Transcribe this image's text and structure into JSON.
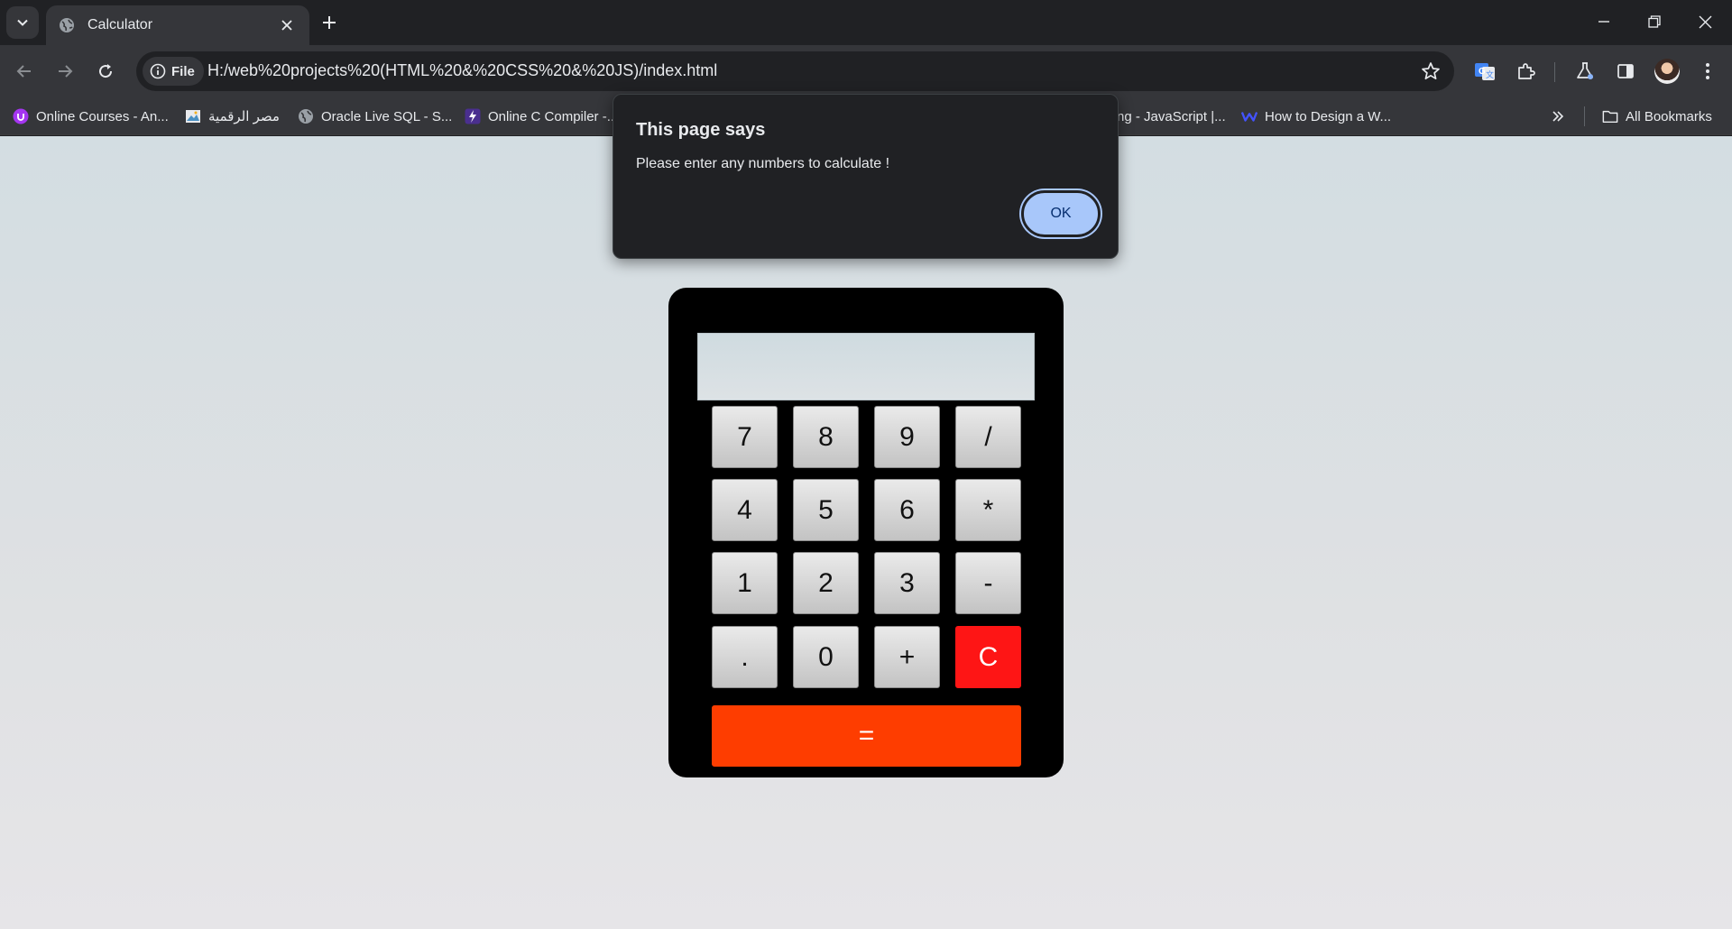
{
  "browser": {
    "tab": {
      "title": "Calculator",
      "favicon": "globe-icon"
    },
    "address": {
      "scheme_chip": "File",
      "url": "H:/web%20projects%20(HTML%20&%20CSS%20&%20JS)/index.html"
    },
    "bookmarks": [
      {
        "label": "Online Courses - An...",
        "icon": "udemy-icon"
      },
      {
        "label": "مصر الرقمية",
        "icon": "image-icon"
      },
      {
        "label": "Oracle Live SQL - S...",
        "icon": "globe-icon"
      },
      {
        "label": "Online C Compiler -...",
        "icon": "lightning-icon"
      },
      {
        "label": "ng - JavaScript |...",
        "icon": "none"
      },
      {
        "label": "How to Design a W...",
        "icon": "w-logo-icon"
      }
    ],
    "all_bookmarks": "All Bookmarks"
  },
  "dialog": {
    "title": "This page says",
    "message": "Please enter any numbers to calculate !",
    "ok_label": "OK"
  },
  "calculator": {
    "display_value": "",
    "keys": [
      "7",
      "8",
      "9",
      "/",
      "4",
      "5",
      "6",
      "*",
      "1",
      "2",
      "3",
      "-",
      ".",
      "0",
      "+",
      "C"
    ],
    "equals_label": "=",
    "colors": {
      "body": "#000000",
      "clear": "#fe1515",
      "equals": "#fe3d00",
      "key": "#d4d4d4"
    }
  }
}
